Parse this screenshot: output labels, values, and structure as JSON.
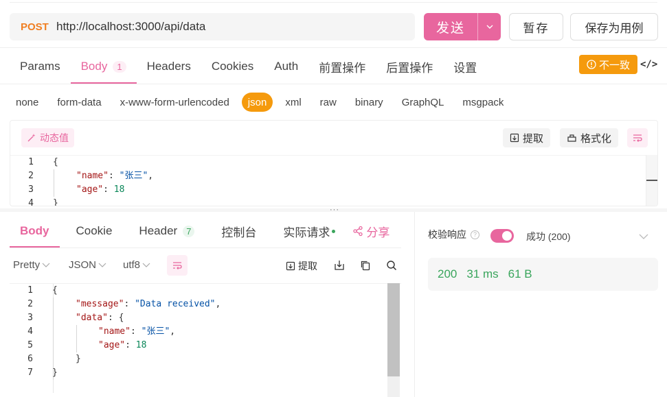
{
  "request": {
    "method": "POST",
    "url": "http://localhost:3000/api/data",
    "send_label": "发送",
    "save_label": "暂存",
    "save_case_label": "保存为用例"
  },
  "request_tabs": [
    {
      "label": "Params"
    },
    {
      "label": "Body",
      "badge": "1",
      "active": true
    },
    {
      "label": "Headers"
    },
    {
      "label": "Cookies"
    },
    {
      "label": "Auth"
    },
    {
      "label": "前置操作"
    },
    {
      "label": "后置操作"
    },
    {
      "label": "设置"
    }
  ],
  "mismatch_badge": "不一致",
  "body_types": [
    "none",
    "form-data",
    "x-www-form-urlencoded",
    "json",
    "xml",
    "raw",
    "binary",
    "GraphQL",
    "msgpack"
  ],
  "active_body_type": "json",
  "editor_toolbar": {
    "dynamic_value": "动态值",
    "extract": "提取",
    "format": "格式化"
  },
  "request_body_lines": [
    {
      "n": "1",
      "text": "{"
    },
    {
      "n": "2",
      "key": "\"name\"",
      "value": "\"张三\"",
      "trail": ","
    },
    {
      "n": "3",
      "key": "\"age\"",
      "num": "18"
    },
    {
      "n": "4",
      "text": "}"
    }
  ],
  "response_tabs": {
    "body": "Body",
    "cookie": "Cookie",
    "header": "Header",
    "header_count": "7",
    "console": "控制台",
    "actual_request": "实际请求",
    "share": "分享"
  },
  "response_toolbar": {
    "pretty": "Pretty",
    "json": "JSON",
    "encoding": "utf8",
    "extract": "提取"
  },
  "response_body_lines": [
    {
      "n": "1",
      "text": "{"
    },
    {
      "n": "2",
      "key": "\"message\"",
      "value": "\"Data received\"",
      "trail": ","
    },
    {
      "n": "3",
      "key": "\"data\"",
      "text_after": ": {"
    },
    {
      "n": "4",
      "key": "\"name\"",
      "value": "\"张三\"",
      "trail": ","
    },
    {
      "n": "5",
      "key": "\"age\"",
      "num": "18"
    },
    {
      "n": "6",
      "text": "}"
    },
    {
      "n": "7",
      "text": "}"
    }
  ],
  "validation": {
    "label": "校验响应",
    "result": "成功 (200)",
    "enabled": true
  },
  "stats": {
    "status": "200",
    "time": "31 ms",
    "size": "61 B"
  },
  "colors": {
    "accent": "#e8669e",
    "warning": "#f59a0d",
    "success": "#3aa55c",
    "method": "#f07e21"
  }
}
